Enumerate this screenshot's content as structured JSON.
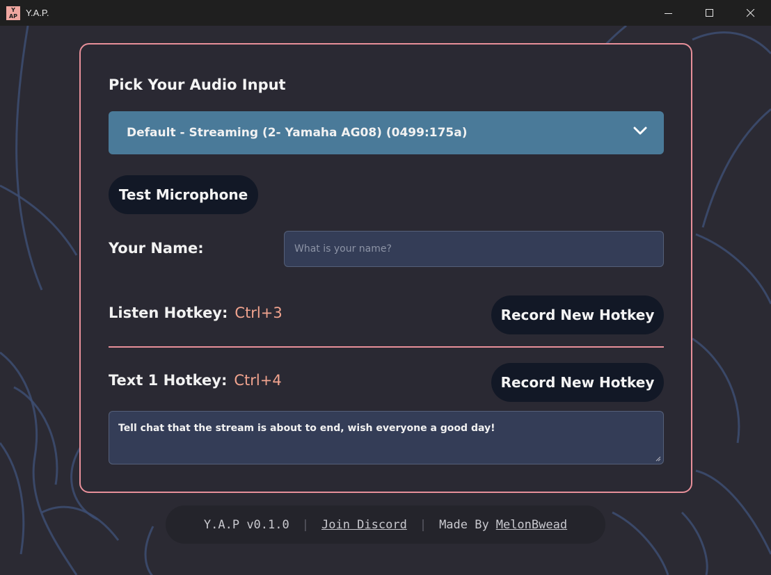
{
  "window": {
    "title": "Y.A.P.",
    "logo_text_top": "Y",
    "logo_text_bottom": "AP"
  },
  "audio": {
    "section_title": "Pick Your Audio Input",
    "selected_device": "Default - Streaming (2- Yamaha AG08) (0499:175a)",
    "test_button": "Test Microphone"
  },
  "name": {
    "label": "Your Name:",
    "value": "",
    "placeholder": "What is your name?"
  },
  "listen_hotkey": {
    "label": "Listen Hotkey:",
    "value": "Ctrl+3",
    "button": "Record New Hotkey"
  },
  "text1_hotkey": {
    "label": "Text 1 Hotkey:",
    "value": "Ctrl+4",
    "button": "Record New Hotkey",
    "message": "Tell chat that the stream is about to end, wish everyone a good day!"
  },
  "footer": {
    "version": "Y.A.P v0.1.0",
    "separator": "|",
    "discord_link": "Join Discord",
    "made_by_prefix": "Made By",
    "author_link": "MelonBwead"
  },
  "colors": {
    "accent": "#e8909a",
    "hotkey_value": "#f2a48f",
    "select_bg": "#4a7a99",
    "button_bg": "#121826",
    "input_bg": "#343d57"
  }
}
